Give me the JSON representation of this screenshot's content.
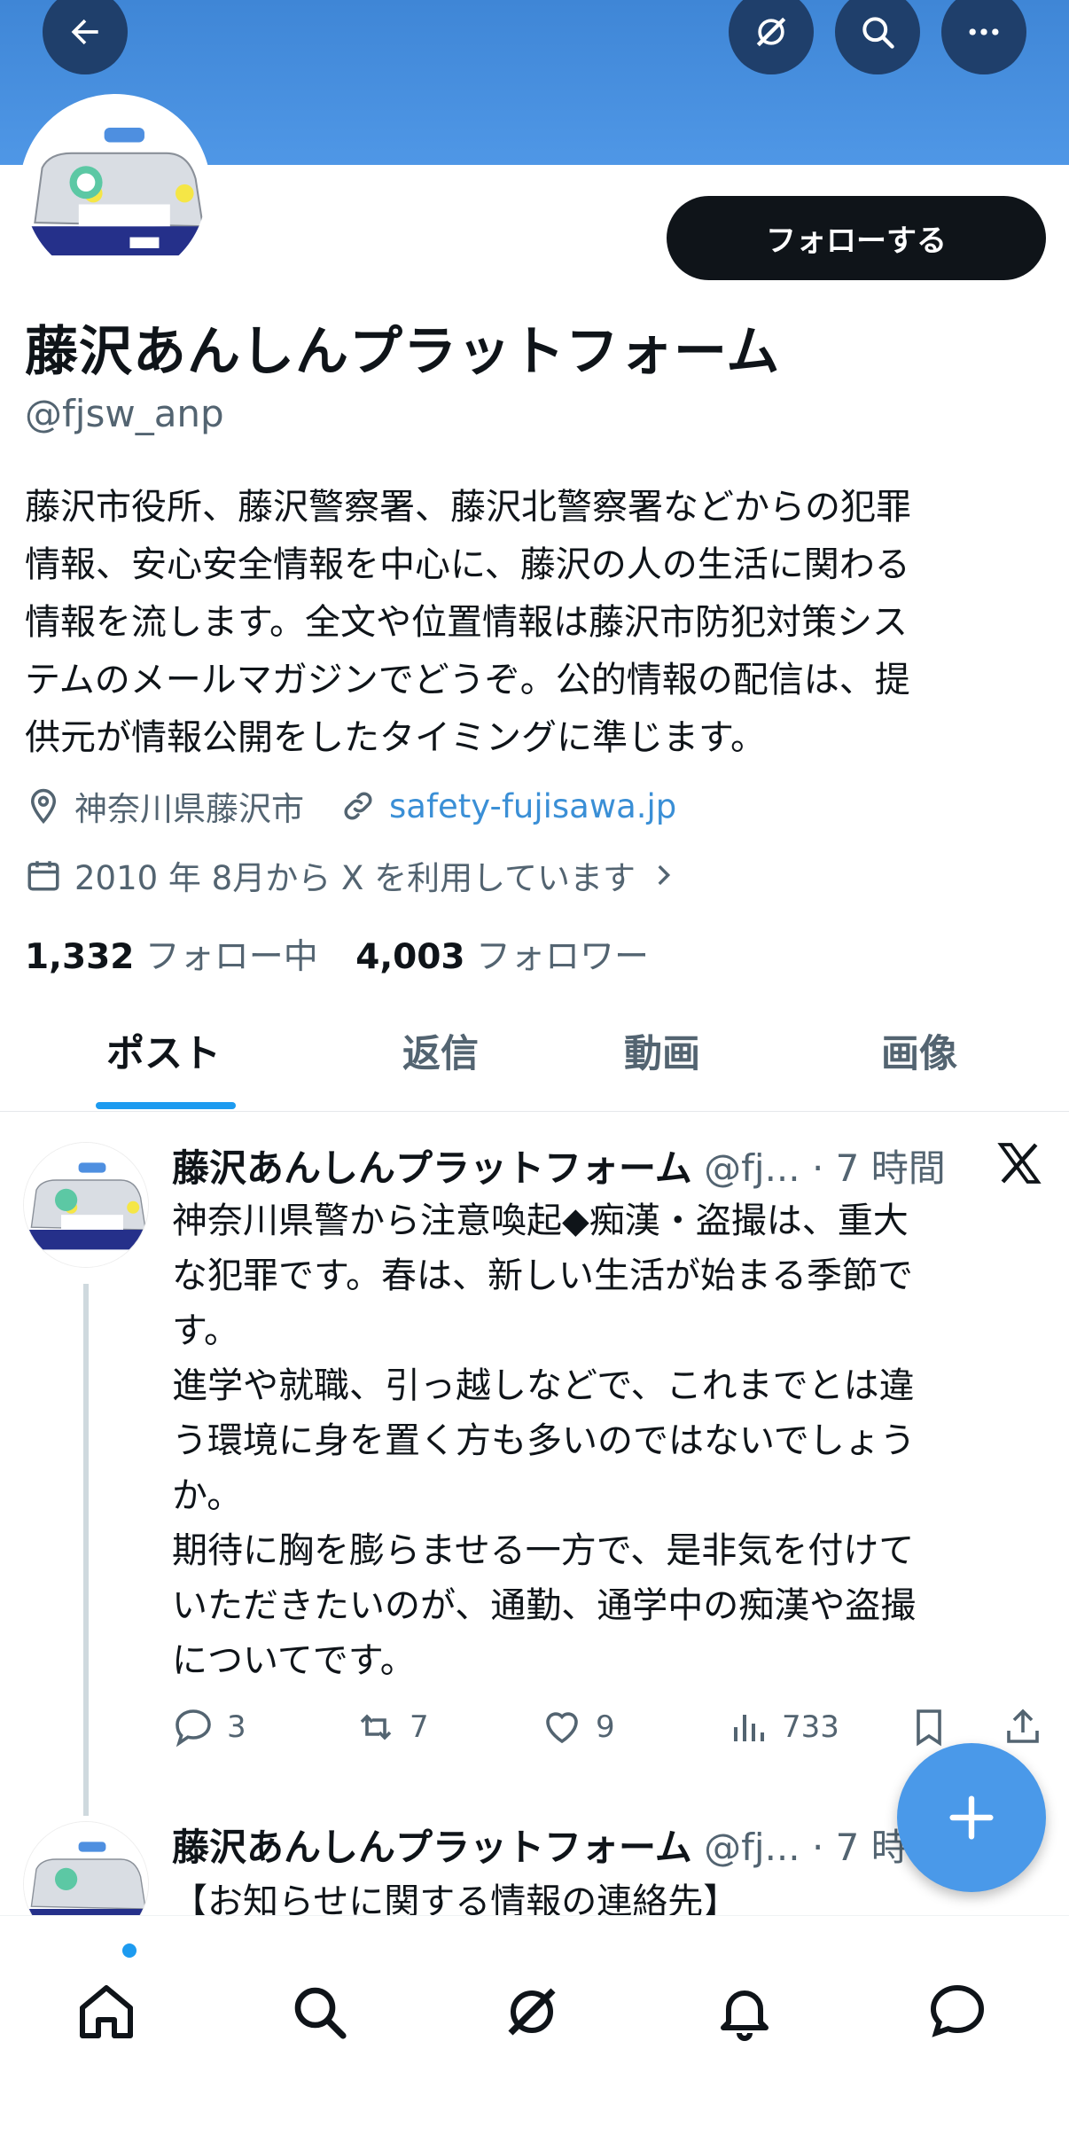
{
  "header": {
    "back_icon": "arrow-left-icon",
    "grok_icon": "grok-icon",
    "search_icon": "search-icon",
    "more_icon": "more-icon",
    "banner_color": "#4a93e3"
  },
  "profile": {
    "follow_label": "フォローする",
    "name": "藤沢あんしんプラットフォーム",
    "handle": "@fjsw_anp",
    "bio": "藤沢市役所、藤沢警察署、藤沢北警察署などからの犯罪\n情報、安心安全情報を中心に、藤沢の人の生活に関わる\n情報を流します。全文や位置情報は藤沢市防犯対策シス\nテムのメールマガジンでどうぞ。公的情報の配信は、提\n供元が情報公開をしたタイミングに準じます。",
    "location": "神奈川県藤沢市",
    "website": "safety-fujisawa.jp",
    "joined": "2010 年 8月から X を利用しています",
    "following_count": "1,332",
    "following_label": "フォロー中",
    "followers_count": "4,003",
    "followers_label": "フォロワー"
  },
  "tabs": [
    "ポスト",
    "返信",
    "動画",
    "画像"
  ],
  "posts": [
    {
      "name": "藤沢あんしんプラットフォーム",
      "meta": "@fj... · 7 時間",
      "text": "神奈川県警から注意喚起◆痴漢・盗撮は、重大\nな犯罪です。春は、新しい生活が始まる季節で\nす。\n進学や就職、引っ越しなどで、これまでとは違\nう環境に身を置く方も多いのではないでしょう\nか。\n期待に胸を膨らませる一方で、是非気を付けて\nいただきたいのが、通勤、通学中の痴漢や盗撮\nについてです。",
      "replies": "3",
      "reposts": "7",
      "likes": "9",
      "views": "733"
    },
    {
      "name": "藤沢あんしんプラットフォーム",
      "meta": "@fj... · 7 時",
      "text": "【お知らせに関する情報の連絡先】"
    }
  ],
  "nav": [
    "home-icon",
    "search-icon",
    "grok-icon",
    "notifications-icon",
    "messages-icon"
  ],
  "colors": {
    "accent": "#1d9bf0",
    "text": "#0f1419",
    "muted": "#536471",
    "fab": "#4a99e9"
  }
}
